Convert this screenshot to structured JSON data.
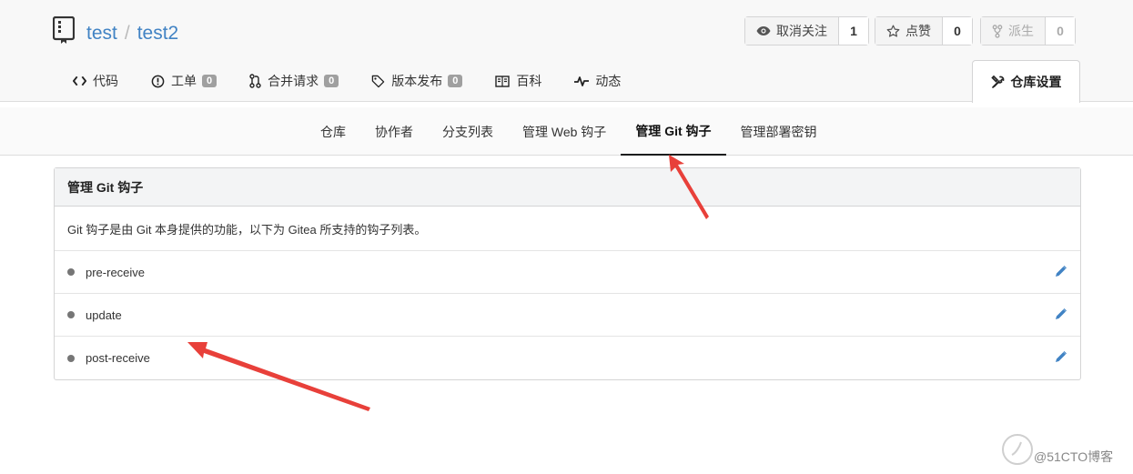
{
  "repo": {
    "owner": "test",
    "separator": "/",
    "name": "test2"
  },
  "actions": [
    {
      "label": "取消关注",
      "count": "1",
      "icon": "eye-icon"
    },
    {
      "label": "点赞",
      "count": "0",
      "icon": "star-icon"
    },
    {
      "label": "派生",
      "count": "0",
      "icon": "fork-icon",
      "disabled": true
    }
  ],
  "tabs": [
    {
      "label": "代码",
      "icon": "code-icon"
    },
    {
      "label": "工单",
      "badge": "0",
      "icon": "issue-icon"
    },
    {
      "label": "合并请求",
      "badge": "0",
      "icon": "pull-request-icon"
    },
    {
      "label": "版本发布",
      "badge": "0",
      "icon": "tag-icon"
    },
    {
      "label": "百科",
      "icon": "book-icon"
    },
    {
      "label": "动态",
      "icon": "pulse-icon"
    }
  ],
  "settings_tab": {
    "label": "仓库设置",
    "icon": "tools-icon"
  },
  "subnav": [
    {
      "label": "仓库"
    },
    {
      "label": "协作者"
    },
    {
      "label": "分支列表"
    },
    {
      "label": "管理 Web 钩子"
    },
    {
      "label": "管理 Git 钩子",
      "active": true
    },
    {
      "label": "管理部署密钥"
    }
  ],
  "panel": {
    "title": "管理 Git 钩子",
    "description": "Git 钩子是由 Git 本身提供的功能，以下为 Gitea 所支持的钩子列表。",
    "hooks": [
      {
        "name": "pre-receive"
      },
      {
        "name": "update"
      },
      {
        "name": "post-receive"
      }
    ]
  },
  "colors": {
    "link": "#4183c4",
    "annotation_arrow": "#e8403a",
    "edit_icon": "#4183c4"
  },
  "watermark": {
    "text": "@51CTO博客"
  }
}
